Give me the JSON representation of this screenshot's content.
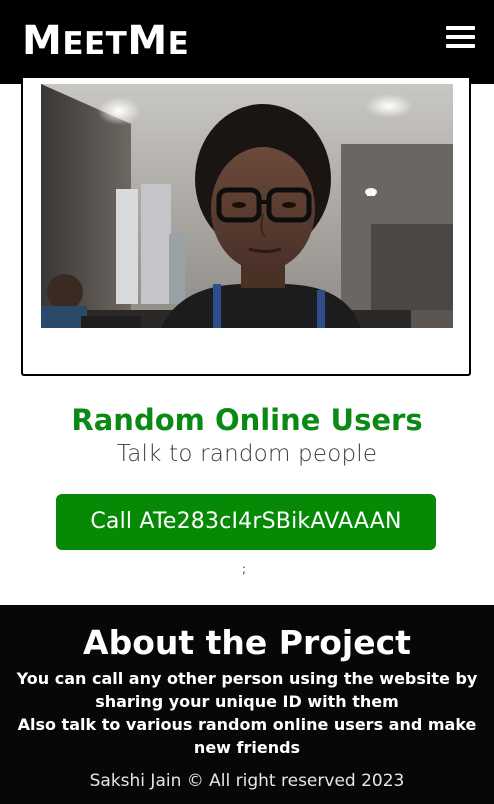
{
  "header": {
    "logo_text": "MeetMe",
    "menu_icon": "hamburger-menu-icon"
  },
  "video": {
    "description_icon": "webcam-video-feed"
  },
  "random_section": {
    "title": "Random Online Users",
    "subtitle": "Talk to random people",
    "call_button_label": "Call ATe283cI4rSBikAVAAAN",
    "stray_text": ";"
  },
  "footer": {
    "title": "About the Project",
    "line1": "You can call any other person using the website by",
    "line2": "sharing your unique ID with them",
    "line3": "Also talk to various random online users and make",
    "line4": "new friends",
    "copyright": "Sakshi Jain © All right reserved 2023"
  },
  "colors": {
    "header_bg": "#000000",
    "accent_green": "#0a8a14",
    "button_green": "#068a06",
    "footer_bg": "#070707"
  }
}
